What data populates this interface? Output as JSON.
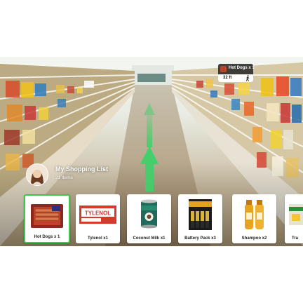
{
  "navigation": {
    "target_item": "Hot Dogs x 1",
    "distance": "32 ft",
    "walk_icon": "walking-person-icon"
  },
  "shopping_list": {
    "title": "My Shopping List",
    "count": "21 Items",
    "items": [
      {
        "label": "Hot Dogs x 1",
        "icon": "hot-dogs-icon",
        "selected": true
      },
      {
        "label": "Tylenol x1",
        "icon": "tylenol-icon",
        "selected": false
      },
      {
        "label": "Coconut Milk x1",
        "icon": "coconut-milk-icon",
        "selected": false
      },
      {
        "label": "Battery Pack x3",
        "icon": "battery-pack-icon",
        "selected": false
      },
      {
        "label": "Shampoo x2",
        "icon": "shampoo-icon",
        "selected": false
      },
      {
        "label": "Tra",
        "icon": "product-icon",
        "selected": false
      }
    ]
  },
  "colors": {
    "selected_border": "#3cc84a",
    "arrow": "#3ed06a"
  }
}
